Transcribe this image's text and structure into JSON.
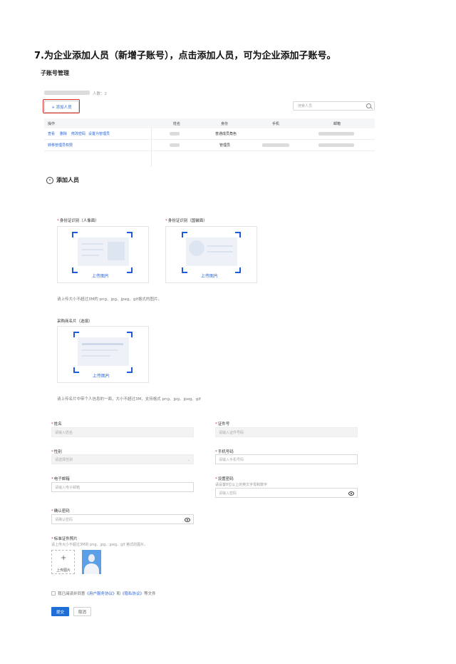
{
  "heading": "7.为企业添加人员（新增子账号），点击添加人员，可为企业添加子账号。",
  "section_title": "子账号管理",
  "account": {
    "count_label": "人数：2"
  },
  "toolbar": {
    "add_label": "+ 添加人员",
    "search_placeholder": "搜索人员"
  },
  "table": {
    "headers": [
      "操作",
      "姓名",
      "身份",
      "手机",
      "邮箱"
    ],
    "rows": [
      {
        "actions": [
          "查看",
          "删除",
          "修改密码",
          "设置为管理员"
        ],
        "role": "普通成员角色"
      },
      {
        "actions": [
          "转移管理员权限"
        ],
        "role": "管理员"
      }
    ]
  },
  "form": {
    "back_title": "添加人员",
    "id_front_label": "身份证识别（人像面）",
    "id_back_label": "身份证识别（国徽面）",
    "upload_label": "上传图片",
    "id_hint": "请上传大小不超过3M的 png、jpg、jpeg、gif格式的图片。",
    "card_label": "采购商名片（选填）",
    "card_hint": "请上传名片中带个人信息的一面，大小不超过3M，支持格式 png、jpg、jpeg、gif",
    "name_label": "姓名",
    "name_placeholder": "请输入姓名",
    "idno_label": "证件号",
    "idno_placeholder": "请输入证件号码",
    "gender_label": "性别",
    "gender_placeholder": "请选择性别",
    "phone_label": "手机号码",
    "phone_placeholder": "请输入手机号码",
    "email_label": "电子邮箱",
    "email_placeholder": "请输入电子邮箱",
    "password_label": "设置密码",
    "password_hint": "请设置8位以上的英文字母和数字",
    "password_placeholder": "请输入密码",
    "confirm_label": "确认密码",
    "confirm_placeholder": "请确认密码",
    "photo_label": "标准证件照片",
    "photo_hint": "请上传大小不超过3M的 png、jpg、jpeg、gif 格式的图片。",
    "photo_upload_label": "上传图片",
    "agree_prefix": "我已阅读并同意",
    "agree_link1": "《用户服务协议》",
    "agree_and": "和",
    "agree_link2": "《隐私协议》",
    "agree_suffix": "等文件",
    "submit_label": "提交",
    "cancel_label": "取消"
  },
  "colors": {
    "accent": "#1f6ed6",
    "link": "#2b66d6",
    "highlight": "#e02b2b"
  }
}
